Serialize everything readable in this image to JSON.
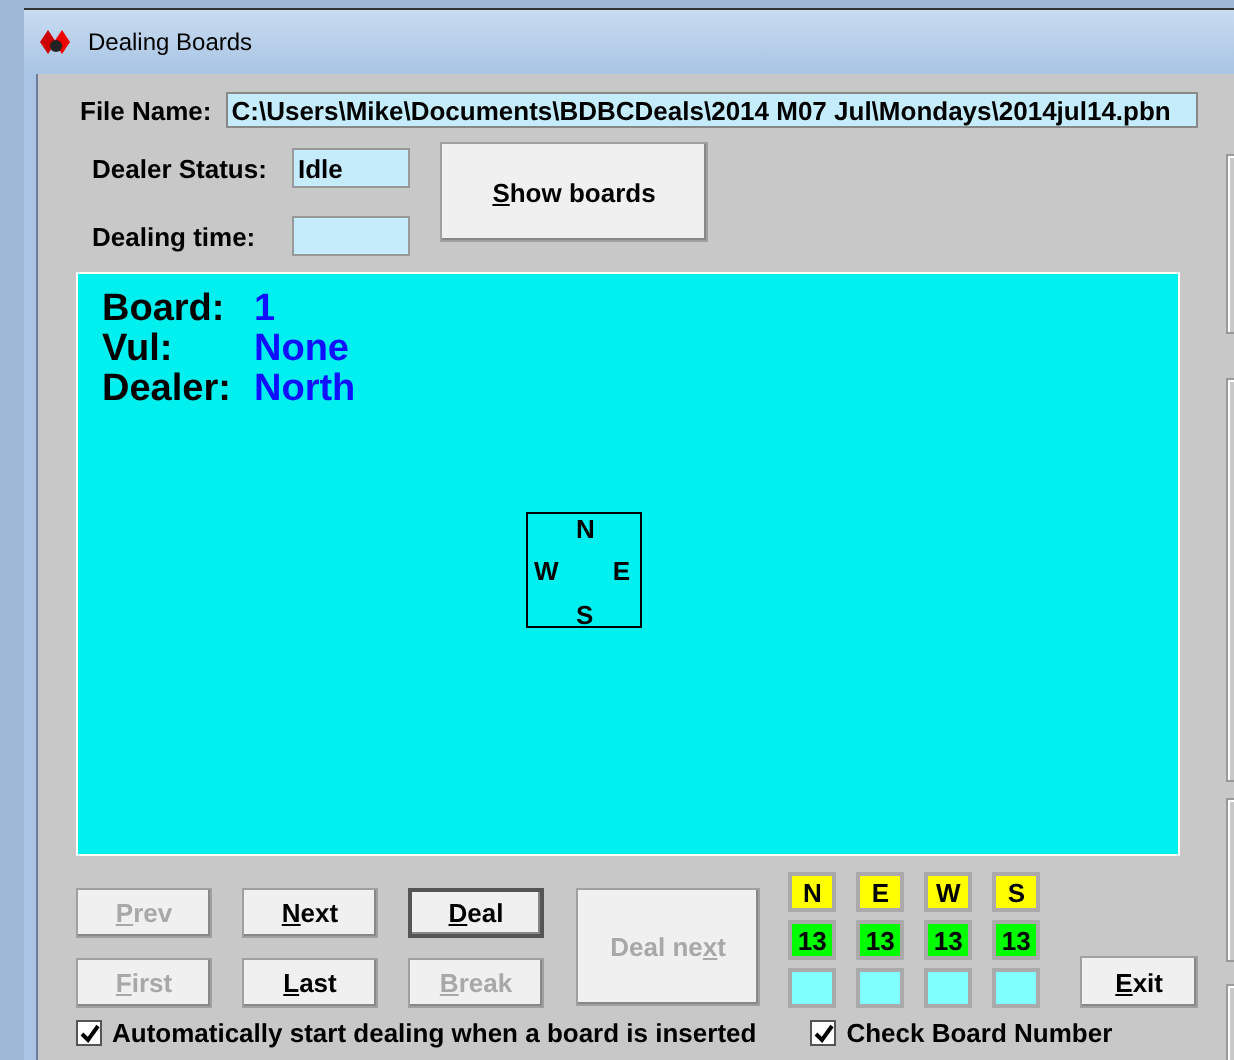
{
  "window": {
    "title": "Dealing Boards"
  },
  "file_name": {
    "label": "File Name:",
    "value": "C:\\Users\\Mike\\Documents\\BDBCDeals\\2014 M07 Jul\\Mondays\\2014jul14.pbn"
  },
  "dealer_status": {
    "label": "Dealer Status:",
    "value": "Idle"
  },
  "dealing_time": {
    "label": "Dealing time:"
  },
  "show_boards": {
    "key": "S",
    "post": "how boards",
    "disabled": false
  },
  "board_panel": {
    "board_label": "Board:",
    "board": "1",
    "vul_label": "Vul:",
    "vul": "None",
    "dealer_label": "Dealer:",
    "dealer": "North",
    "compass": {
      "north": "N",
      "west": "W",
      "east": "E",
      "south": "S"
    }
  },
  "buttons_left": [
    {
      "key": "P",
      "post": "rev",
      "disabled": true,
      "default": false
    },
    {
      "key": "N",
      "post": "ext",
      "disabled": false,
      "default": false
    },
    {
      "key": "D",
      "post": "eal",
      "disabled": false,
      "default": true
    },
    {
      "key": "F",
      "post": "irst",
      "disabled": true,
      "default": false
    },
    {
      "key": "L",
      "post": "ast",
      "disabled": false,
      "default": false
    },
    {
      "key": "B",
      "post": "reak",
      "disabled": true,
      "default": false
    }
  ],
  "deal_next": {
    "pre": "Deal ne",
    "key": "x",
    "post": "t",
    "disabled": true
  },
  "hands": [
    {
      "seat": "N",
      "count": "13"
    },
    {
      "seat": "E",
      "count": "13"
    },
    {
      "seat": "W",
      "count": "13"
    },
    {
      "seat": "S",
      "count": "13"
    }
  ],
  "exit": {
    "key": "E",
    "post": "xit",
    "disabled": false
  },
  "options": [
    {
      "label": "Automatically start dealing when a board is inserted",
      "checked": true
    },
    {
      "label": "Check Board Number",
      "checked": true
    }
  ]
}
